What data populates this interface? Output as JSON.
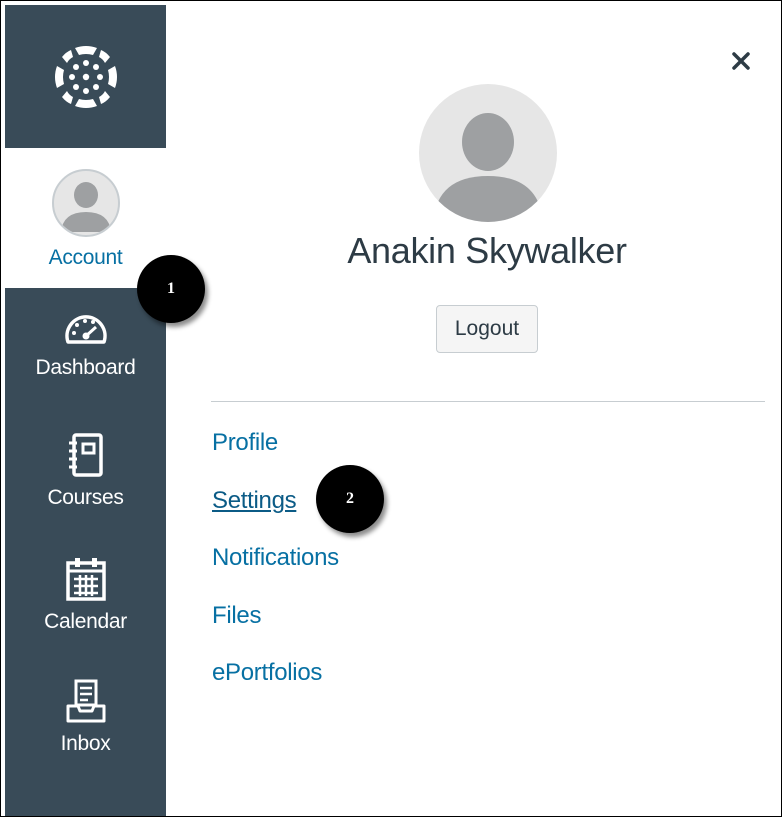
{
  "nav": {
    "logo_icon": "canvas-logo-icon",
    "items": [
      {
        "label": "Account",
        "icon": "user-avatar-icon",
        "active": true
      },
      {
        "label": "Dashboard",
        "icon": "speedometer-icon"
      },
      {
        "label": "Courses",
        "icon": "notebook-icon"
      },
      {
        "label": "Calendar",
        "icon": "calendar-icon"
      },
      {
        "label": "Inbox",
        "icon": "inbox-icon"
      }
    ]
  },
  "tray": {
    "close_icon": "close-icon",
    "user_name": "Anakin Skywalker",
    "logout_label": "Logout",
    "links": [
      {
        "label": "Profile"
      },
      {
        "label": "Settings"
      },
      {
        "label": "Notifications"
      },
      {
        "label": "Files"
      },
      {
        "label": "ePortfolios"
      }
    ]
  },
  "callouts": [
    "1",
    "2"
  ],
  "colors": {
    "nav_bg": "#394b58",
    "link": "#0770a3",
    "text": "#2d3b45",
    "callout_bg": "#000000"
  }
}
